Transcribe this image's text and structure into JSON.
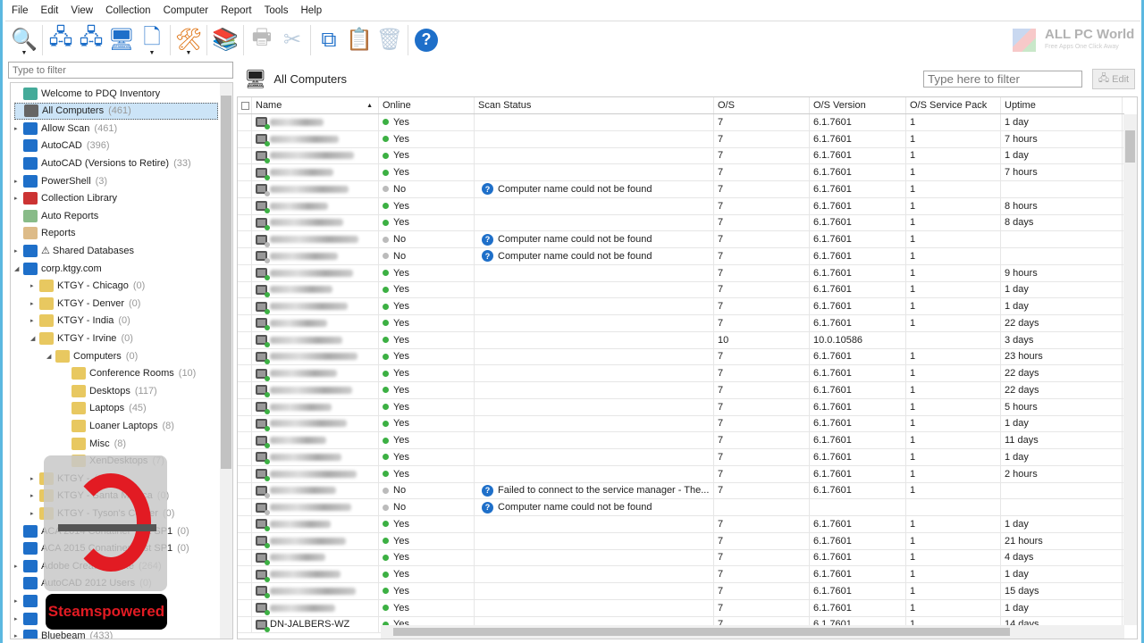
{
  "menu": [
    "File",
    "Edit",
    "View",
    "Collection",
    "Computer",
    "Report",
    "Tools",
    "Help"
  ],
  "toolbar": [
    {
      "icon": "search-icon",
      "dd": true,
      "color": "#e07a1e",
      "glyph": "🔍"
    },
    {
      "icon": "scan-collection-icon",
      "glyph": "🖧",
      "color": "#1e6fc9"
    },
    {
      "icon": "scan-computers-icon",
      "glyph": "🖧",
      "color": "#1e6fc9"
    },
    {
      "icon": "computer-icon",
      "glyph": "🖥",
      "color": "#1e6fc9"
    },
    {
      "icon": "new-document-icon",
      "dd": true,
      "glyph": "🗋",
      "color": "#1e6fc9"
    },
    {
      "icon": "tools-icon",
      "dd": true,
      "glyph": "🛠",
      "color": "#e07a1e"
    },
    {
      "icon": "collection-library-icon",
      "glyph": "📚",
      "color": "#c33"
    },
    {
      "icon": "print-icon",
      "glyph": "🖶",
      "color": "#bbb"
    },
    {
      "icon": "cut-icon",
      "glyph": "✂",
      "color": "#bcd"
    },
    {
      "icon": "copy-icon",
      "glyph": "⧉",
      "color": "#1e6fc9"
    },
    {
      "icon": "paste-icon",
      "glyph": "📋",
      "color": "#e07a1e"
    },
    {
      "icon": "delete-icon",
      "glyph": "🗑",
      "color": "#bcd"
    },
    {
      "icon": "help-icon",
      "glyph": "?",
      "color": "#1e6fc9"
    }
  ],
  "tree_filter_placeholder": "Type to filter",
  "tree": [
    {
      "label": "Welcome to PDQ Inventory",
      "count": "",
      "level": 0,
      "arrow": "",
      "icon": "welcome-icon",
      "color": "#4a9"
    },
    {
      "label": "All Computers",
      "count": "(461)",
      "level": 0,
      "arrow": "",
      "icon": "computer-icon",
      "color": "#666",
      "selected": true
    },
    {
      "label": "Allow Scan",
      "count": "(461)",
      "level": 0,
      "arrow": "▸",
      "icon": "collection-icon",
      "color": "#1e6fc9"
    },
    {
      "label": "AutoCAD",
      "count": "(396)",
      "level": 0,
      "arrow": "",
      "icon": "collection-icon",
      "color": "#1e6fc9"
    },
    {
      "label": "AutoCAD (Versions to Retire)",
      "count": "(33)",
      "level": 0,
      "arrow": "",
      "icon": "collection-icon",
      "color": "#1e6fc9"
    },
    {
      "label": "PowerShell",
      "count": "(3)",
      "level": 0,
      "arrow": "▸",
      "icon": "collection-icon",
      "color": "#1e6fc9"
    },
    {
      "label": "Collection Library",
      "count": "",
      "level": 0,
      "arrow": "▸",
      "icon": "library-icon",
      "color": "#c33"
    },
    {
      "label": "Auto Reports",
      "count": "",
      "level": 0,
      "arrow": "",
      "icon": "auto-report-icon",
      "color": "#8b8"
    },
    {
      "label": "Reports",
      "count": "",
      "level": 0,
      "arrow": "",
      "icon": "report-icon",
      "color": "#db8"
    },
    {
      "label": "⚠ Shared Databases",
      "count": "",
      "level": 0,
      "arrow": "▸",
      "icon": "database-icon",
      "color": "#1e6fc9"
    },
    {
      "label": "corp.ktgy.com",
      "count": "",
      "level": 0,
      "arrow": "◢",
      "icon": "domain-icon",
      "color": "#1e6fc9"
    },
    {
      "label": "KTGY - Chicago",
      "count": "(0)",
      "level": 1,
      "arrow": "▸",
      "icon": "folder-icon",
      "color": "#e8c860"
    },
    {
      "label": "KTGY - Denver",
      "count": "(0)",
      "level": 1,
      "arrow": "▸",
      "icon": "folder-icon",
      "color": "#e8c860"
    },
    {
      "label": "KTGY - India",
      "count": "(0)",
      "level": 1,
      "arrow": "▸",
      "icon": "folder-icon",
      "color": "#e8c860"
    },
    {
      "label": "KTGY - Irvine",
      "count": "(0)",
      "level": 1,
      "arrow": "◢",
      "icon": "folder-icon",
      "color": "#e8c860"
    },
    {
      "label": "Computers",
      "count": "(0)",
      "level": 2,
      "arrow": "◢",
      "icon": "folder-icon",
      "color": "#e8c860"
    },
    {
      "label": "Conference Rooms",
      "count": "(10)",
      "level": 3,
      "arrow": "",
      "icon": "folder-icon",
      "color": "#e8c860"
    },
    {
      "label": "Desktops",
      "count": "(117)",
      "level": 3,
      "arrow": "",
      "icon": "folder-icon",
      "color": "#e8c860"
    },
    {
      "label": "Laptops",
      "count": "(45)",
      "level": 3,
      "arrow": "",
      "icon": "folder-icon",
      "color": "#e8c860"
    },
    {
      "label": "Loaner Laptops",
      "count": "(8)",
      "level": 3,
      "arrow": "",
      "icon": "folder-icon",
      "color": "#e8c860"
    },
    {
      "label": "Misc",
      "count": "(8)",
      "level": 3,
      "arrow": "",
      "icon": "folder-icon",
      "color": "#e8c860"
    },
    {
      "label": "XenDesktops",
      "count": "(7)",
      "level": 3,
      "arrow": "",
      "icon": "folder-icon",
      "color": "#e8c860"
    },
    {
      "label": "KTGY -",
      "count": "(0)",
      "level": 1,
      "arrow": "▸",
      "icon": "folder-icon",
      "color": "#e8c860"
    },
    {
      "label": "KTGY - Santa Monica",
      "count": "(0)",
      "level": 1,
      "arrow": "▸",
      "icon": "folder-icon",
      "color": "#e8c860"
    },
    {
      "label": "KTGY - Tyson's Corner",
      "count": "(0)",
      "level": 1,
      "arrow": "▸",
      "icon": "folder-icon",
      "color": "#e8c860"
    },
    {
      "label": "ACA 2014 Conatiner Test SP1",
      "count": "(0)",
      "level": 0,
      "arrow": "",
      "icon": "collection-icon",
      "color": "#1e6fc9"
    },
    {
      "label": "ACA 2015 Conatiner Test SP1",
      "count": "(0)",
      "level": 0,
      "arrow": "",
      "icon": "collection-icon",
      "color": "#1e6fc9"
    },
    {
      "label": "Adobe Creative Suite",
      "count": "(264)",
      "level": 0,
      "arrow": "▸",
      "icon": "collection-icon",
      "color": "#1e6fc9"
    },
    {
      "label": "AutoCAD 2012 Users",
      "count": "(0)",
      "level": 0,
      "arrow": "",
      "icon": "collection-icon",
      "color": "#1e6fc9"
    },
    {
      "label": "",
      "count": "",
      "level": 0,
      "arrow": "▸",
      "icon": "collection-icon",
      "color": "#1e6fc9"
    },
    {
      "label": "",
      "count": "",
      "level": 0,
      "arrow": "▸",
      "icon": "collection-icon",
      "color": "#1e6fc9"
    },
    {
      "label": "Bluebeam",
      "count": "(433)",
      "level": 0,
      "arrow": "▸",
      "icon": "collection-icon",
      "color": "#1e6fc9"
    }
  ],
  "main": {
    "title": "All Computers",
    "filter_placeholder": "Type here to filter",
    "edit_label": "Edit",
    "columns": [
      "Name",
      "Online",
      "Scan Status",
      "O/S",
      "O/S Version",
      "O/S Service Pack",
      "Uptime"
    ],
    "rows": [
      [
        "",
        "Yes",
        "",
        "7",
        "6.1.7601",
        "1",
        "1 day"
      ],
      [
        "",
        "Yes",
        "",
        "7",
        "6.1.7601",
        "1",
        "7 hours"
      ],
      [
        "",
        "Yes",
        "",
        "7",
        "6.1.7601",
        "1",
        "1 day"
      ],
      [
        "",
        "Yes",
        "",
        "7",
        "6.1.7601",
        "1",
        "7 hours"
      ],
      [
        "",
        "No",
        "Computer name could not be found",
        "7",
        "6.1.7601",
        "1",
        ""
      ],
      [
        "",
        "Yes",
        "",
        "7",
        "6.1.7601",
        "1",
        "8 hours"
      ],
      [
        "",
        "Yes",
        "",
        "7",
        "6.1.7601",
        "1",
        "8 days"
      ],
      [
        "",
        "No",
        "Computer name could not be found",
        "7",
        "6.1.7601",
        "1",
        ""
      ],
      [
        "",
        "No",
        "Computer name could not be found",
        "7",
        "6.1.7601",
        "1",
        ""
      ],
      [
        "",
        "Yes",
        "",
        "7",
        "6.1.7601",
        "1",
        "9 hours"
      ],
      [
        "",
        "Yes",
        "",
        "7",
        "6.1.7601",
        "1",
        "1 day"
      ],
      [
        "",
        "Yes",
        "",
        "7",
        "6.1.7601",
        "1",
        "1 day"
      ],
      [
        "",
        "Yes",
        "",
        "7",
        "6.1.7601",
        "1",
        "22 days"
      ],
      [
        "",
        "Yes",
        "",
        "10",
        "10.0.10586",
        "",
        "3 days"
      ],
      [
        "",
        "Yes",
        "",
        "7",
        "6.1.7601",
        "1",
        "23 hours"
      ],
      [
        "",
        "Yes",
        "",
        "7",
        "6.1.7601",
        "1",
        "22 days"
      ],
      [
        "",
        "Yes",
        "",
        "7",
        "6.1.7601",
        "1",
        "22 days"
      ],
      [
        "",
        "Yes",
        "",
        "7",
        "6.1.7601",
        "1",
        "5 hours"
      ],
      [
        "",
        "Yes",
        "",
        "7",
        "6.1.7601",
        "1",
        "1 day"
      ],
      [
        "",
        "Yes",
        "",
        "7",
        "6.1.7601",
        "1",
        "11 days"
      ],
      [
        "",
        "Yes",
        "",
        "7",
        "6.1.7601",
        "1",
        "1 day"
      ],
      [
        "",
        "Yes",
        "",
        "7",
        "6.1.7601",
        "1",
        "2 hours"
      ],
      [
        "",
        "No",
        "Failed to connect to the service manager - The...",
        "7",
        "6.1.7601",
        "1",
        ""
      ],
      [
        "",
        "No",
        "Computer name could not be found",
        "",
        "",
        "",
        ""
      ],
      [
        "",
        "Yes",
        "",
        "7",
        "6.1.7601",
        "1",
        "1 day"
      ],
      [
        "",
        "Yes",
        "",
        "7",
        "6.1.7601",
        "1",
        "21 hours"
      ],
      [
        "",
        "Yes",
        "",
        "7",
        "6.1.7601",
        "1",
        "4 days"
      ],
      [
        "",
        "Yes",
        "",
        "7",
        "6.1.7601",
        "1",
        "1 day"
      ],
      [
        "",
        "Yes",
        "",
        "7",
        "6.1.7601",
        "1",
        "15 days"
      ],
      [
        "",
        "Yes",
        "",
        "7",
        "6.1.7601",
        "1",
        "1 day"
      ],
      [
        "DN-JALBERS-WZ",
        "Yes",
        "",
        "7",
        "6.1.7601",
        "1",
        "14 days"
      ]
    ]
  },
  "colors": {
    "online": "#3cb043",
    "offline": "#bbb",
    "status_icon": "#1e6fc9",
    "selection": "#cce4f7"
  },
  "watermarks": {
    "top": "ALL PC World",
    "top_sub": "Free Apps One Click Away",
    "bottom": "Steamspowered"
  }
}
